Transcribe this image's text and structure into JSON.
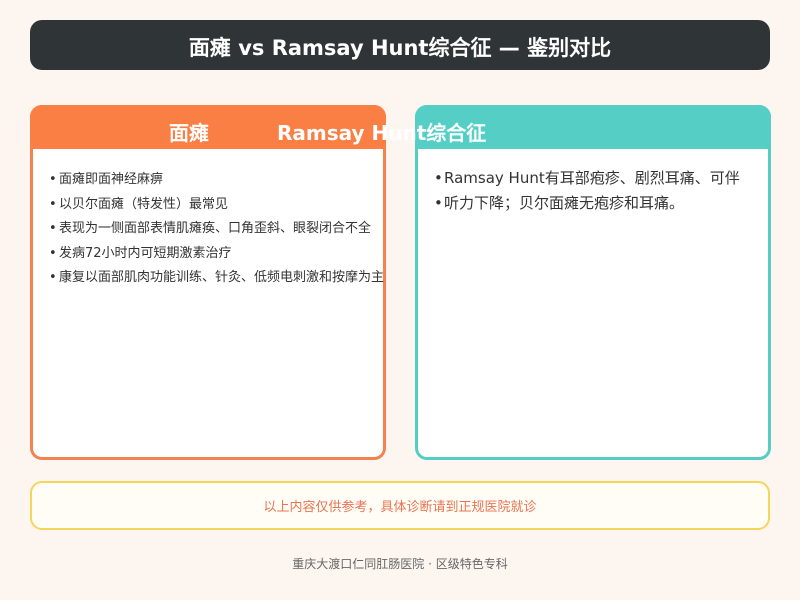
{
  "header": {
    "title": "面瘫 vs Ramsay Hunt综合征 — 鉴别对比"
  },
  "left_panel": {
    "title": "面瘫",
    "items": [
      "面瘫即面神经麻痹",
      "以贝尔面瘫（特发性）最常见",
      "表现为一侧面部表情肌瘫痪、口角歪斜、眼裂闭合不全",
      "发病72小时内可短期激素治疗",
      "康复以面部肌肉功能训练、针灸、低频电刺激和按摩为主"
    ]
  },
  "right_panel": {
    "title": "Ramsay Hunt综合征",
    "items": [
      "Ramsay Hunt有耳部疱疹、剧烈耳痛、可伴",
      "听力下降；贝尔面瘫无疱疹和耳痛。"
    ]
  },
  "disclaimer": "以上内容仅供参考，具体诊断请到正规医院就诊",
  "footer": "重庆大渡口仁同肛肠医院 · 区级特色专科",
  "colors": {
    "header_bg": "#2f3437",
    "left_accent": "#fa7f44",
    "right_accent": "#55cfc5",
    "disclaimer_border": "#f5d55a",
    "disclaimer_text": "#e87452"
  }
}
